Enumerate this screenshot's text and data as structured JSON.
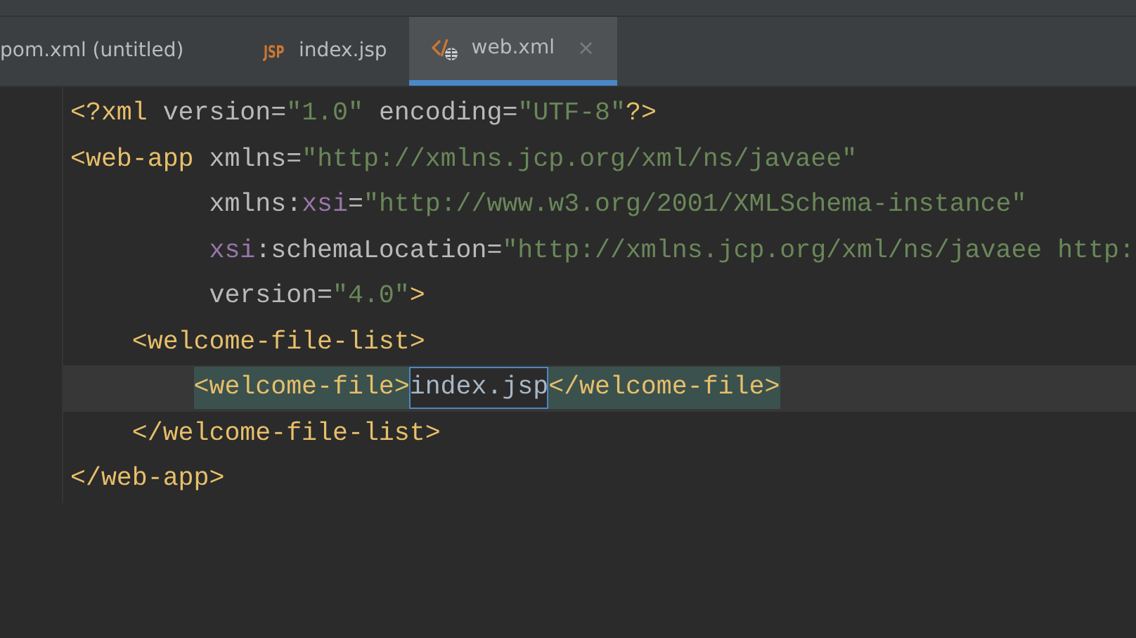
{
  "tabs": [
    {
      "label": "pom.xml (untitled)",
      "kind": "plain",
      "selected": false,
      "closable": false
    },
    {
      "label": "index.jsp",
      "kind": "jsp",
      "icon_text": "JSP",
      "selected": false,
      "closable": false
    },
    {
      "label": "web.xml",
      "kind": "xml",
      "selected": true,
      "closable": true,
      "close": "×"
    }
  ],
  "editor": {
    "lines": [
      {
        "current": false,
        "tokens": [
          {
            "kind": "tag",
            "t": "<?xml "
          },
          {
            "kind": "attr",
            "t": "version"
          },
          {
            "kind": "attr",
            "t": "="
          },
          {
            "kind": "val",
            "t": "\"1.0\" "
          },
          {
            "kind": "attr",
            "t": "encoding"
          },
          {
            "kind": "attr",
            "t": "="
          },
          {
            "kind": "val",
            "t": "\"UTF-8\""
          },
          {
            "kind": "tag",
            "t": "?>"
          }
        ]
      },
      {
        "current": false,
        "tokens": [
          {
            "kind": "tag",
            "t": "<web-app "
          },
          {
            "kind": "attr",
            "t": "xmlns"
          },
          {
            "kind": "attr",
            "t": "="
          },
          {
            "kind": "val",
            "t": "\"http://xmlns.jcp.org/xml/ns/javaee\""
          }
        ]
      },
      {
        "current": false,
        "tokens": [
          {
            "kind": "attr",
            "t": "         xmlns:"
          },
          {
            "kind": "ns",
            "t": "xsi"
          },
          {
            "kind": "attr",
            "t": "="
          },
          {
            "kind": "val",
            "t": "\"http://www.w3.org/2001/XMLSchema-instance\""
          }
        ]
      },
      {
        "current": false,
        "tokens": [
          {
            "kind": "ns",
            "t": "         xsi"
          },
          {
            "kind": "attr",
            "t": ":schemaLocation="
          },
          {
            "kind": "val",
            "t": "\"http://xmlns.jcp.org/xml/ns/javaee http:"
          }
        ]
      },
      {
        "current": false,
        "tokens": [
          {
            "kind": "attr",
            "t": "         version="
          },
          {
            "kind": "val",
            "t": "\"4.0\""
          },
          {
            "kind": "tag",
            "t": ">"
          }
        ]
      },
      {
        "current": false,
        "tokens": [
          {
            "kind": "tag",
            "t": "    <welcome-file-list>"
          }
        ]
      },
      {
        "current": true,
        "tokens": [
          {
            "kind": "tag",
            "t": "        <welcome-file>",
            "match": true
          },
          {
            "kind": "text",
            "t": "index.jsp",
            "boxed": true
          },
          {
            "kind": "tag",
            "t": "</welcome-file>",
            "match": true
          }
        ]
      },
      {
        "current": false,
        "tokens": [
          {
            "kind": "tag",
            "t": "    </welcome-file-list>"
          }
        ]
      },
      {
        "current": false,
        "tokens": [
          {
            "kind": "tag",
            "t": "</web-app>"
          }
        ]
      }
    ]
  }
}
